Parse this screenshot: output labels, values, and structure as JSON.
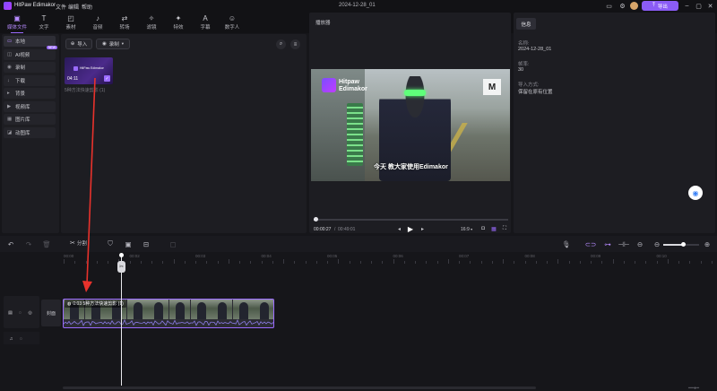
{
  "app": {
    "title": "HitPaw Edimakor",
    "menus": [
      "文件",
      "编辑",
      "帮助"
    ],
    "project_name": "2024-12-28_01",
    "export_label": "导出"
  },
  "toolbar": {
    "items": [
      {
        "label": "媒体文件",
        "icon": "folder-icon",
        "glyph": "▣",
        "active": true
      },
      {
        "label": "文字",
        "icon": "text-icon",
        "glyph": "T",
        "active": false
      },
      {
        "label": "素材",
        "icon": "sticker-icon",
        "glyph": "◰",
        "active": false
      },
      {
        "label": "音频",
        "icon": "music-icon",
        "glyph": "♪",
        "active": false
      },
      {
        "label": "转场",
        "icon": "transition-icon",
        "glyph": "⇄",
        "active": false
      },
      {
        "label": "滤镜",
        "icon": "filter-icon",
        "glyph": "✧",
        "active": false
      },
      {
        "label": "特效",
        "icon": "effects-icon",
        "glyph": "✦",
        "active": false
      },
      {
        "label": "字幕",
        "icon": "subtitle-icon",
        "glyph": "A",
        "active": false
      },
      {
        "label": "数字人",
        "icon": "avatar-icon",
        "glyph": "☺",
        "active": false
      }
    ]
  },
  "sidebar": {
    "items": [
      {
        "label": "本地",
        "glyph": "▭",
        "active": true
      },
      {
        "label": "AI视频",
        "glyph": "◫",
        "badge": "NEW"
      },
      {
        "label": "录制",
        "glyph": "◉"
      },
      {
        "label": "下载",
        "glyph": "↓"
      },
      {
        "label": "背景",
        "glyph": "▸"
      },
      {
        "label": "视频库",
        "glyph": "▶"
      },
      {
        "label": "图片库",
        "glyph": "▦"
      },
      {
        "label": "动图库",
        "glyph": "◪"
      }
    ]
  },
  "media": {
    "import_label": "导入",
    "record_label": "录制",
    "clip": {
      "duration": "04:11",
      "name": "5种方法快速剪影 (1)",
      "brand": "HitPaw Edimakor"
    }
  },
  "player": {
    "title": "播放器",
    "overlay_brand_line1": "Hitpaw",
    "overlay_brand_line2": "Edimakor",
    "subtitle": "今天 教大家使用Edimakor",
    "current_time": "00:00:27",
    "total_time": "00:49:01",
    "aspect_ratio": "16:9",
    "progress": 0.01
  },
  "info": {
    "tab_label": "信息",
    "name_label": "名称:",
    "name_value": "2024-12-28_01",
    "fps_label": "帧率:",
    "fps_value": "30",
    "import_label": "导入方式:",
    "import_value": "保留在原有位置"
  },
  "timeline": {
    "split_label": "分割",
    "ticks": [
      "00:00",
      "00:02",
      "00:03",
      "00:04",
      "00:05",
      "00:06",
      "00:07",
      "00:08",
      "00:09",
      "00:10"
    ],
    "track_cover_label": "封面",
    "clip_label": "0:03 5种方法快速剪影 (1)"
  },
  "colors": {
    "accent": "#9b6bff",
    "export_bg": "#8b5cf6",
    "annotation_arrow": "#e8322c",
    "audio_wave": "#8b7ce6"
  }
}
